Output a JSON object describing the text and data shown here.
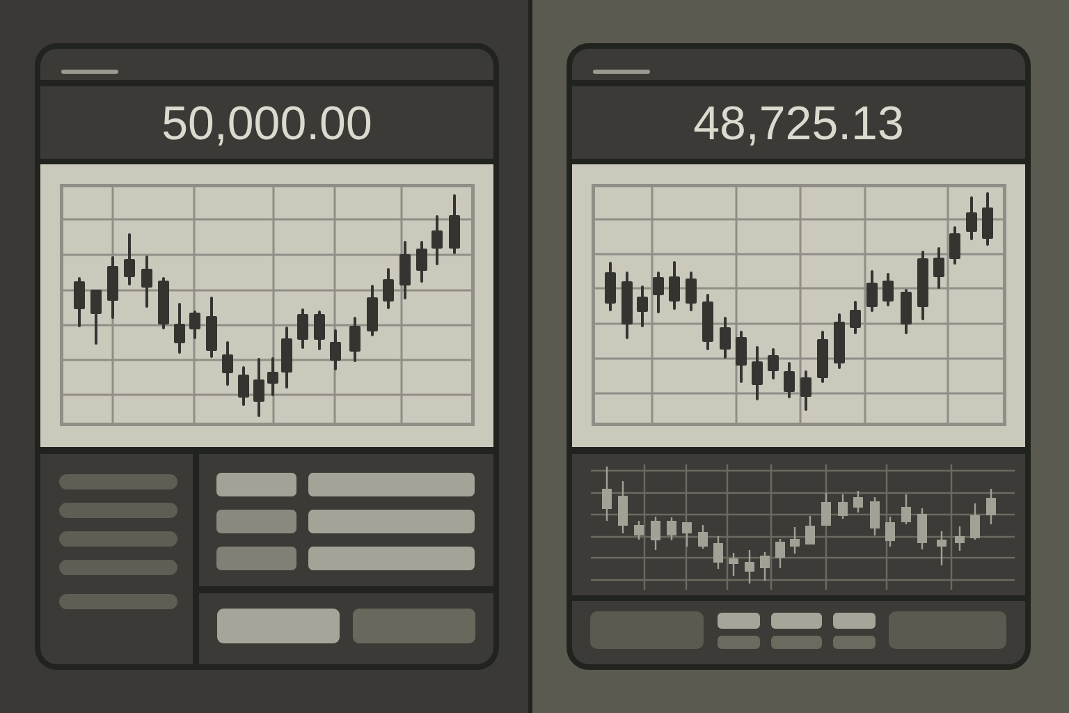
{
  "panels": [
    {
      "kind": "order-form",
      "price": "50,000.00"
    },
    {
      "kind": "mini-chart",
      "price": "48,725.13"
    }
  ]
}
